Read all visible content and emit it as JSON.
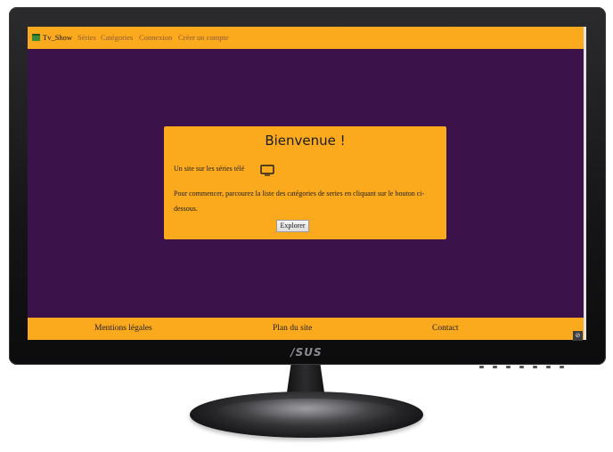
{
  "navbar": {
    "brand_label": "Tv_Show",
    "items": [
      {
        "label": "Séries"
      },
      {
        "label": "Catégories"
      },
      {
        "label": "Connexion"
      },
      {
        "label": "Créer un compte"
      }
    ]
  },
  "welcome_card": {
    "title": "Bienvenue !",
    "subtitle": "Un site sur les séries télé",
    "body": "Pour commencer, parcourez la liste des catégories de series en cliquant sur le bouton ci-dessous.",
    "button_label": "Explorer"
  },
  "footer": {
    "items": [
      {
        "label": "Mentions légales"
      },
      {
        "label": "Plan du site"
      },
      {
        "label": "Contact"
      }
    ]
  },
  "corner_button_label": "⊘",
  "monitor_brand": "/SUS",
  "colors": {
    "accent": "#fbaa1e",
    "background": "#3b124a"
  }
}
